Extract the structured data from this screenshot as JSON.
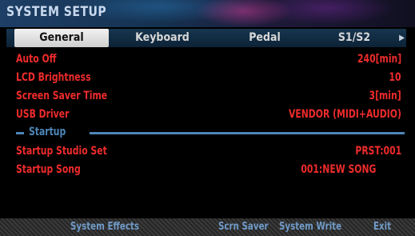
{
  "header": {
    "title": "SYSTEM SETUP"
  },
  "tabs": [
    {
      "label": "General",
      "active": true
    },
    {
      "label": "Keyboard",
      "active": false
    },
    {
      "label": "Pedal",
      "active": false
    },
    {
      "label": "S1/S2",
      "active": false
    }
  ],
  "tabs_more_icon": "triangle-right-icon",
  "settings": [
    {
      "label": "Auto Off",
      "value": "240[min]"
    },
    {
      "label": "LCD Brightness",
      "value": "10"
    },
    {
      "label": "Screen Saver Time",
      "value": "3[min]"
    },
    {
      "label": "USB Driver",
      "value": "VENDOR (MIDI+AUDIO)"
    }
  ],
  "section": {
    "label": "Startup"
  },
  "startup": [
    {
      "label": "Startup Studio Set",
      "value": "PRST:001"
    },
    {
      "label": "Startup Song",
      "value": "001:NEW SONG"
    }
  ],
  "function_bar": [
    {
      "label": "System Effects"
    },
    {
      "label": "Scrn Saver"
    },
    {
      "label": "System Write"
    },
    {
      "label": "Exit"
    }
  ],
  "colors": {
    "param_text": "#ee2b2b",
    "accent_blue": "#4d86b8",
    "title_text": "#c9d9ee",
    "active_tab_bg": "#e6e6e6"
  }
}
